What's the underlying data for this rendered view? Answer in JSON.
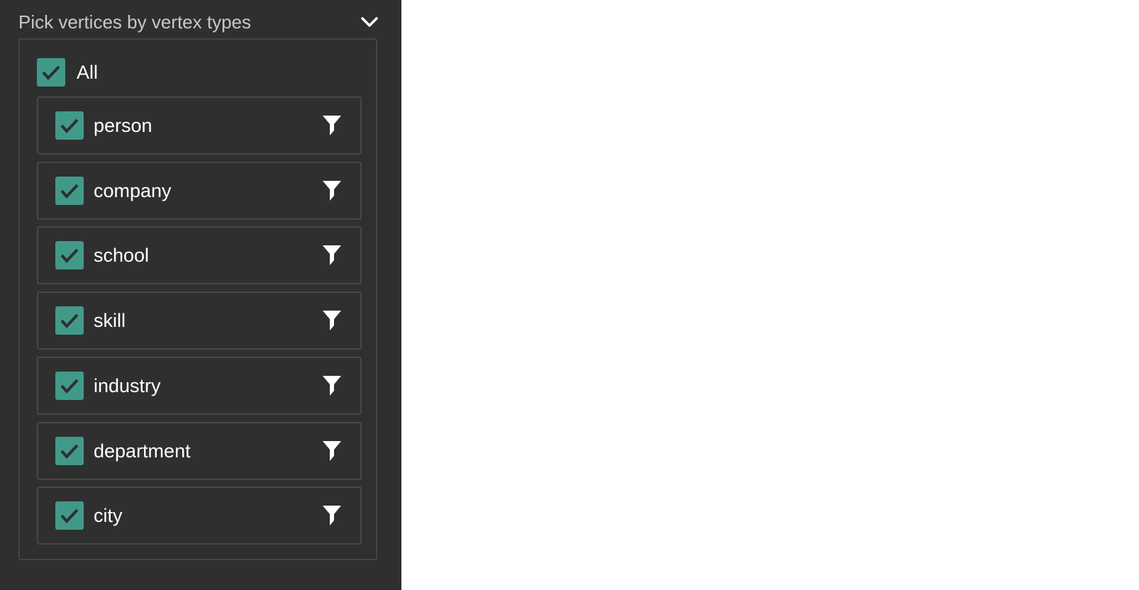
{
  "panel": {
    "title": "Pick vertices by vertex types",
    "collapse_icon": "chevron-down-icon",
    "all": {
      "label": "All",
      "checked": true
    },
    "vertex_types": [
      {
        "label": "person",
        "checked": true,
        "filter_icon": "filter-icon"
      },
      {
        "label": "company",
        "checked": true,
        "filter_icon": "filter-icon"
      },
      {
        "label": "school",
        "checked": true,
        "filter_icon": "filter-icon"
      },
      {
        "label": "skill",
        "checked": true,
        "filter_icon": "filter-icon"
      },
      {
        "label": "industry",
        "checked": true,
        "filter_icon": "filter-icon"
      },
      {
        "label": "department",
        "checked": true,
        "filter_icon": "filter-icon"
      },
      {
        "label": "city",
        "checked": true,
        "filter_icon": "filter-icon"
      }
    ]
  },
  "colors": {
    "panel_bg": "#2f2f2f",
    "checkbox": "#419a89",
    "border": "#474747",
    "text": "#ffffff",
    "title_text": "#c8c8c8"
  }
}
